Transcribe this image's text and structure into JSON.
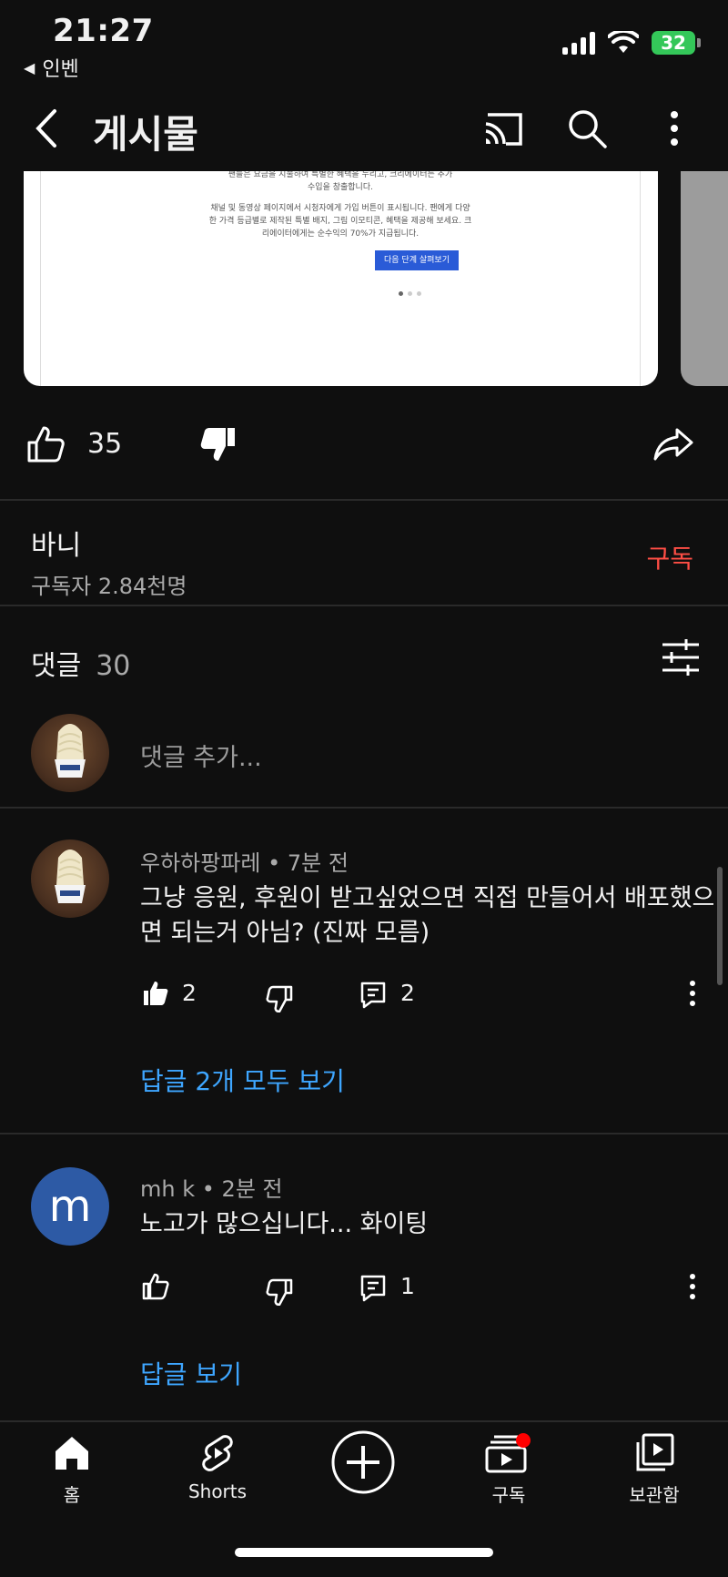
{
  "status": {
    "time": "21:27",
    "back_app": "인벤",
    "battery": "32"
  },
  "appbar": {
    "title": "게시물"
  },
  "post_image": {
    "lines": [
      "팬들은 요금을 지불하여 특별한 혜택을 누리고, 크리에이터는 추가",
      "수입을 창출합니다.",
      "채널 및 동영상 페이지에서 시청자에게 가입 버튼이 표시됩니다. 팬에게 다양",
      "한 가격 등급별로 제작된 특별 배지, 그림 이모티콘, 혜택을 제공해 보세요. 크",
      "리에이터에게는 순수익의 70%가 지급됩니다."
    ],
    "cta": "다음 단계 살펴보기"
  },
  "post_actions": {
    "like_count": "35"
  },
  "channel": {
    "name": "바니",
    "subscribers": "구독자 2.84천명",
    "subscribe_label": "구독"
  },
  "comments_header": {
    "label": "댓글",
    "count": "30"
  },
  "add_comment": {
    "placeholder": "댓글 추가..."
  },
  "comments": [
    {
      "author": "우하하팡파레",
      "time": "• 7분 전",
      "text_line1": "그냥 응원, 후원이 받고싶었으면 직접 만들어서 배포했으",
      "text_line2": "면 되는거 아님? (진짜 모름)",
      "likes": "2",
      "replies": "2",
      "view_replies": "답글 2개 모두 보기"
    },
    {
      "author": "mh k",
      "avatar_letter": "m",
      "time": "• 2분 전",
      "text_line1": "노고가 많으십니다... 화이팅",
      "likes": "",
      "replies": "1",
      "view_replies": "답글 보기"
    }
  ],
  "bottom_nav": [
    {
      "label": "홈",
      "icon": "home-icon"
    },
    {
      "label": "Shorts",
      "icon": "shorts-icon"
    },
    {
      "label": "",
      "icon": "create-icon"
    },
    {
      "label": "구독",
      "icon": "subscriptions-icon"
    },
    {
      "label": "보관함",
      "icon": "library-icon"
    }
  ],
  "colors": {
    "background": "#0f0f0f",
    "subscribe": "#ff4e45",
    "link": "#3ea6ff",
    "badge": "#ff0000",
    "battery": "#34c759"
  }
}
